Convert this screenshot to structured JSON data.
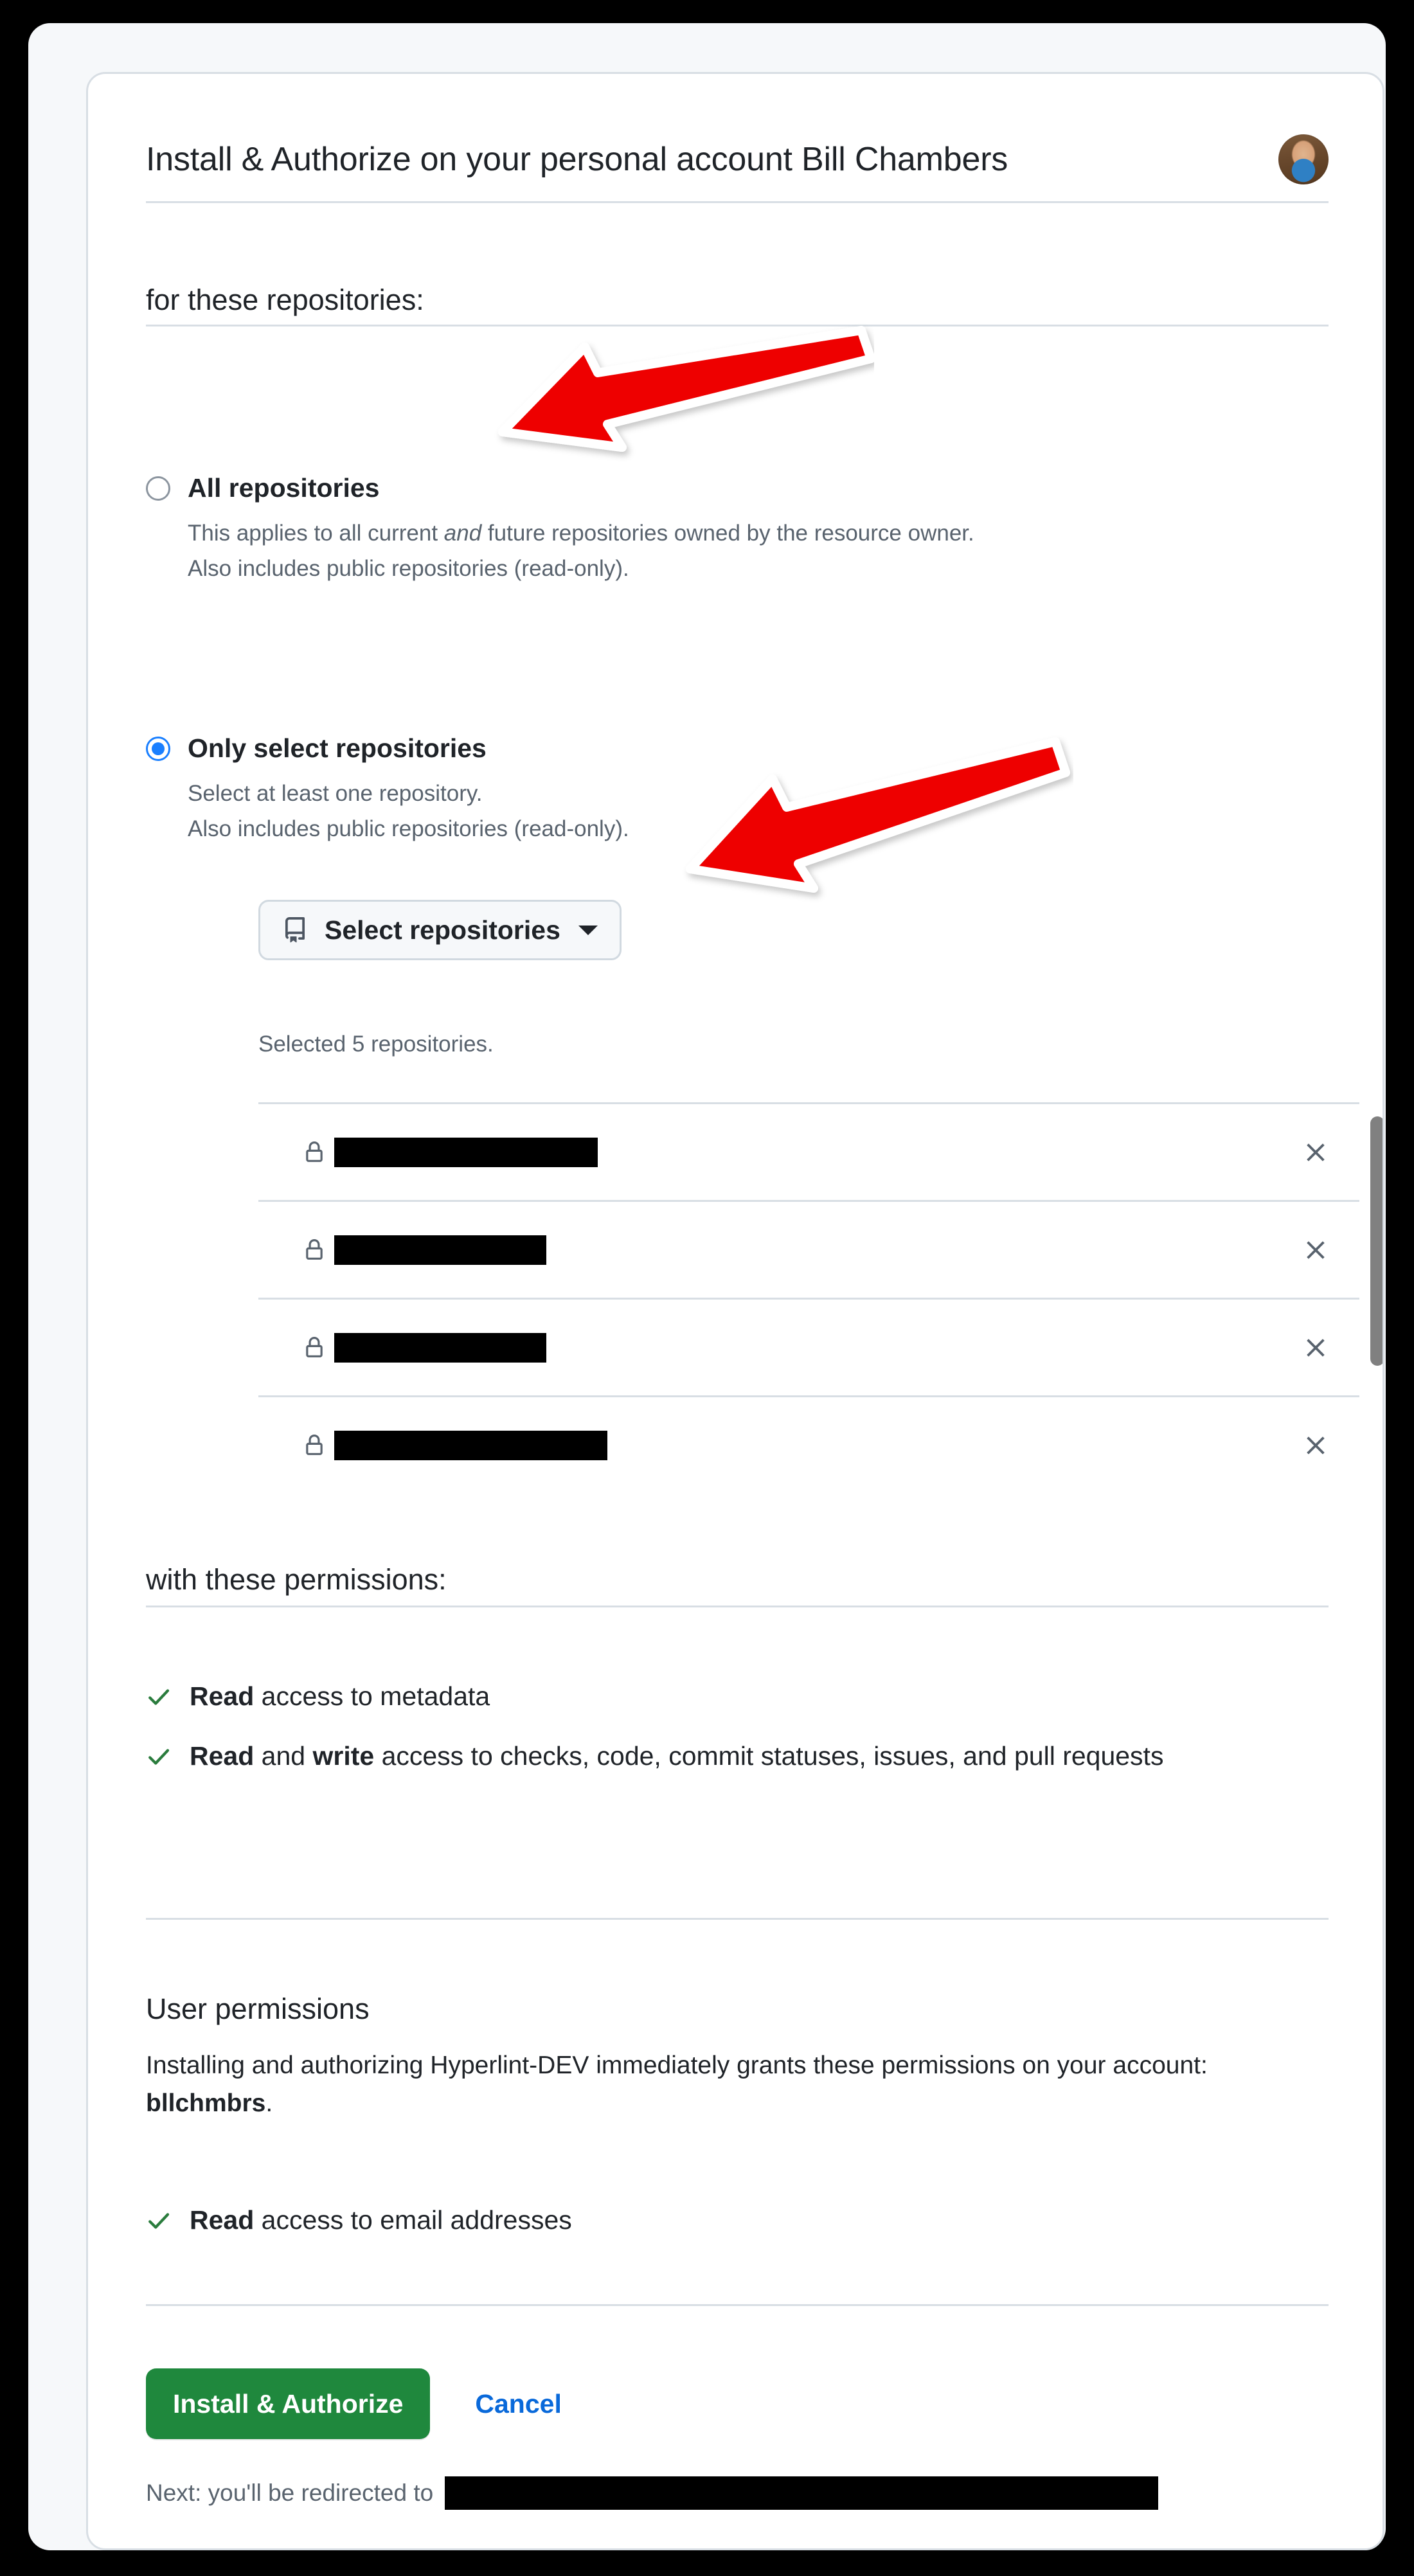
{
  "header": {
    "title": "Install & Authorize on your personal account Bill Chambers",
    "avatar_name": "user-avatar"
  },
  "repositories_section": {
    "heading": "for these repositories:",
    "options": [
      {
        "label": "All repositories",
        "selected": false,
        "desc_line1_a": "This applies to all current ",
        "desc_line1_em": "and",
        "desc_line1_b": " future repositories owned by the resource owner.",
        "desc_line2": "Also includes public repositories (read-only)."
      },
      {
        "label": "Only select repositories",
        "selected": true,
        "desc_line1": "Select at least one repository.",
        "desc_line2": "Also includes public repositories (read-only)."
      }
    ],
    "select_button_label": "Select repositories",
    "selected_count_text": "Selected 5 repositories.",
    "repo_rows": [
      {
        "visibility": "private",
        "name_redacted": true,
        "redact_width": 410
      },
      {
        "visibility": "private",
        "name_redacted": true,
        "redact_width": 330
      },
      {
        "visibility": "private",
        "name_redacted": true,
        "redact_width": 330
      },
      {
        "visibility": "private",
        "name_redacted": true,
        "redact_width": 425
      }
    ],
    "remove_label": "x"
  },
  "permissions_section": {
    "heading": "with these permissions:",
    "items": [
      {
        "bold": "Read",
        "rest": " access to metadata"
      },
      {
        "bold": "Read",
        "mid": " and ",
        "bold2": "write",
        "rest": " access to checks, code, commit statuses, issues, and pull requests"
      }
    ]
  },
  "user_permissions": {
    "title": "User permissions",
    "body_prefix": "Installing and authorizing Hyperlint-DEV immediately grants these permissions on your account: ",
    "account": "bllchmbrs",
    "body_suffix": ".",
    "items": [
      {
        "bold": "Read",
        "rest": " access to email addresses"
      }
    ]
  },
  "footer": {
    "primary_label": "Install & Authorize",
    "cancel_label": "Cancel",
    "next_prefix": "Next: you'll be redirected to",
    "next_redacted": true
  },
  "annotations": {
    "arrow_color": "#ee0000",
    "arrow_outline": "#ffffff",
    "arrows": [
      {
        "name": "arrow-pointing-all-repositories"
      },
      {
        "name": "arrow-pointing-select-repositories-button"
      }
    ]
  },
  "colors": {
    "page_background": "#000000",
    "frame_background": "#f6f8fa",
    "card_background": "#ffffff",
    "border": "#d8dee4",
    "text_primary": "#1f2328",
    "text_muted": "#59636e",
    "accent_blue": "#0969da",
    "radio_blue": "#1a7fff",
    "success_green": "#1f883d",
    "check_green": "#2a7c3d",
    "scrollbar": "#808080"
  }
}
